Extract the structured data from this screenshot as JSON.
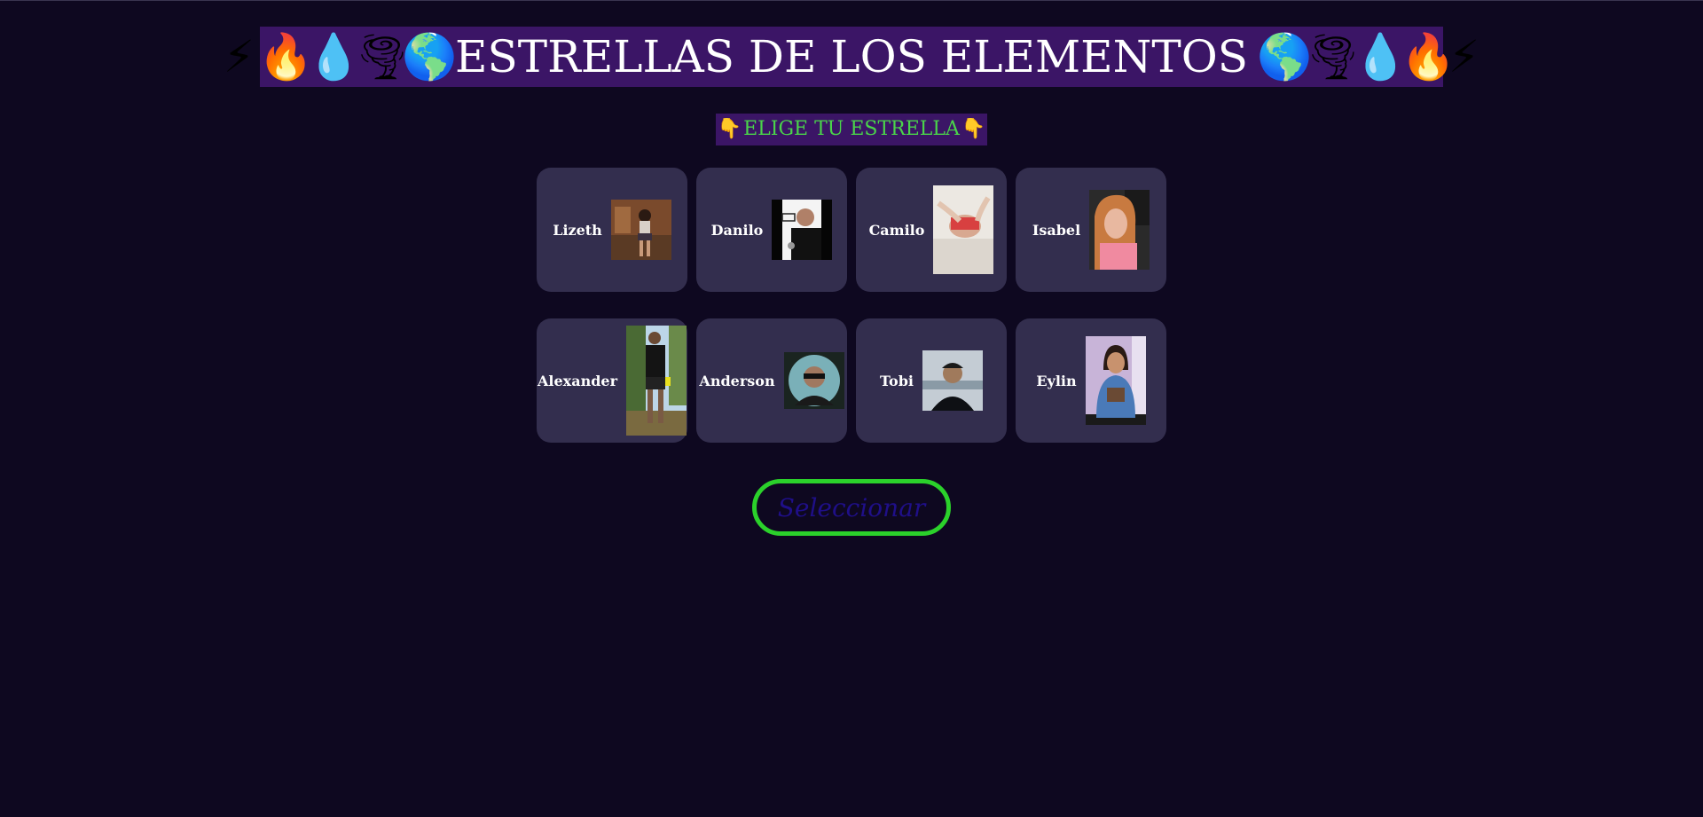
{
  "header": {
    "title": "ESTRELLAS DE LOS ELEMENTOS",
    "left_emojis": [
      {
        "icon": "lightning-icon",
        "glyph": "⚡"
      },
      {
        "icon": "fire-icon",
        "glyph": "🔥"
      },
      {
        "icon": "droplet-icon",
        "glyph": "💧"
      },
      {
        "icon": "tornado-icon",
        "glyph": "🌪"
      },
      {
        "icon": "earth-globe-icon",
        "glyph": "🌎"
      }
    ],
    "right_emojis": [
      {
        "icon": "earth-globe-icon",
        "glyph": "🌎"
      },
      {
        "icon": "tornado-icon",
        "glyph": "🌪"
      },
      {
        "icon": "droplet-icon",
        "glyph": "💧"
      },
      {
        "icon": "fire-icon",
        "glyph": "🔥"
      },
      {
        "icon": "lightning-icon",
        "glyph": "⚡"
      }
    ],
    "banner_color": "#3b1566"
  },
  "subtitle": {
    "text": "ELIGE TU ESTRELLA",
    "left_icon": "👇",
    "right_icon": "👇",
    "text_color": "#4ad44a"
  },
  "characters": [
    {
      "name": "Lizeth",
      "photo": "photo-lizeth"
    },
    {
      "name": "Danilo",
      "photo": "photo-danilo"
    },
    {
      "name": "Camilo",
      "photo": "photo-camilo"
    },
    {
      "name": "Isabel",
      "photo": "photo-isabel"
    },
    {
      "name": "Alexander",
      "photo": "photo-alexander"
    },
    {
      "name": "Anderson",
      "photo": "photo-anderson"
    },
    {
      "name": "Tobi",
      "photo": "photo-tobi"
    },
    {
      "name": "Eylin",
      "photo": "photo-eylin"
    }
  ],
  "select_button": {
    "label": "Seleccionar",
    "border_color": "#2bd12b",
    "text_color": "#1f0f88"
  },
  "colors": {
    "background": "#0e0820",
    "card": "#332e4e"
  }
}
